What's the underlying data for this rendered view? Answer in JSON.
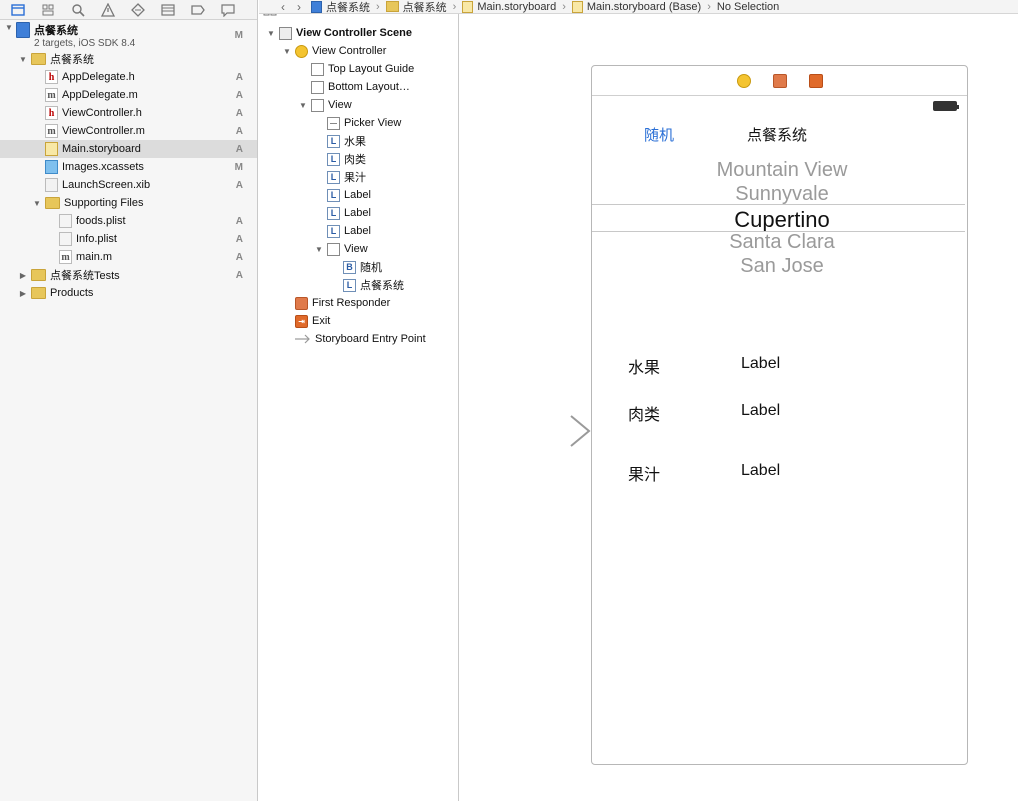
{
  "navigator": {
    "project": {
      "name": "点餐系统",
      "subtitle": "2 targets, iOS SDK 8.4",
      "status": "M"
    },
    "items": [
      {
        "label": "点餐系统",
        "type": "folder",
        "level": 1,
        "open": true,
        "status": ""
      },
      {
        "label": "AppDelegate.h",
        "type": "h",
        "level": 2,
        "status": "A"
      },
      {
        "label": "AppDelegate.m",
        "type": "m",
        "level": 2,
        "status": "A"
      },
      {
        "label": "ViewController.h",
        "type": "h",
        "level": 2,
        "status": "A"
      },
      {
        "label": "ViewController.m",
        "type": "m",
        "level": 2,
        "status": "A"
      },
      {
        "label": "Main.storyboard",
        "type": "sb",
        "level": 2,
        "status": "A",
        "selected": true
      },
      {
        "label": "Images.xcassets",
        "type": "xc",
        "level": 2,
        "status": "M"
      },
      {
        "label": "LaunchScreen.xib",
        "type": "xib",
        "level": 2,
        "status": "A"
      },
      {
        "label": "Supporting Files",
        "type": "folder",
        "level": 2,
        "open": true,
        "status": ""
      },
      {
        "label": "foods.plist",
        "type": "plist",
        "level": 3,
        "status": "A"
      },
      {
        "label": "Info.plist",
        "type": "plist",
        "level": 3,
        "status": "A"
      },
      {
        "label": "main.m",
        "type": "m",
        "level": 3,
        "status": "A"
      },
      {
        "label": "点餐系统Tests",
        "type": "folder",
        "level": 1,
        "open": false,
        "status": "A"
      },
      {
        "label": "Products",
        "type": "folder",
        "level": 1,
        "open": false,
        "status": ""
      }
    ]
  },
  "jumpbar": {
    "crumbs": [
      "点餐系统",
      "点餐系统",
      "Main.storyboard",
      "Main.storyboard (Base)",
      "No Selection"
    ]
  },
  "outline": {
    "scene_title": "View Controller Scene",
    "items": [
      {
        "label": "View Controller",
        "icon": "vc",
        "level": 1,
        "disc": "open"
      },
      {
        "label": "Top Layout Guide",
        "icon": "box",
        "level": 2
      },
      {
        "label": "Bottom Layout…",
        "icon": "box",
        "level": 2
      },
      {
        "label": "View",
        "icon": "box",
        "level": 2,
        "disc": "open"
      },
      {
        "label": "Picker View",
        "icon": "pick",
        "level": 3
      },
      {
        "label": "水果",
        "icon": "lbl",
        "level": 3
      },
      {
        "label": "肉类",
        "icon": "lbl",
        "level": 3
      },
      {
        "label": "果汁",
        "icon": "lbl",
        "level": 3
      },
      {
        "label": "Label",
        "icon": "lbl",
        "level": 3
      },
      {
        "label": "Label",
        "icon": "lbl",
        "level": 3
      },
      {
        "label": "Label",
        "icon": "lbl",
        "level": 3
      },
      {
        "label": "View",
        "icon": "box",
        "level": 3,
        "disc": "open"
      },
      {
        "label": "随机",
        "icon": "btn",
        "level": 4
      },
      {
        "label": "点餐系统",
        "icon": "lbl",
        "level": 4
      },
      {
        "label": "First Responder",
        "icon": "cube",
        "level": 1
      },
      {
        "label": "Exit",
        "icon": "exit",
        "level": 1
      },
      {
        "label": "Storyboard Entry Point",
        "icon": "arrow",
        "level": 1
      }
    ]
  },
  "scene": {
    "random_button": "随机",
    "title": "点餐系统",
    "picker": [
      "Mountain View",
      "Sunnyvale",
      "Cupertino",
      "Santa Clara",
      "San Jose"
    ],
    "rows": [
      {
        "name": "水果",
        "value": "Label"
      },
      {
        "name": "肉类",
        "value": "Label"
      },
      {
        "name": "果汁",
        "value": "Label"
      }
    ]
  }
}
